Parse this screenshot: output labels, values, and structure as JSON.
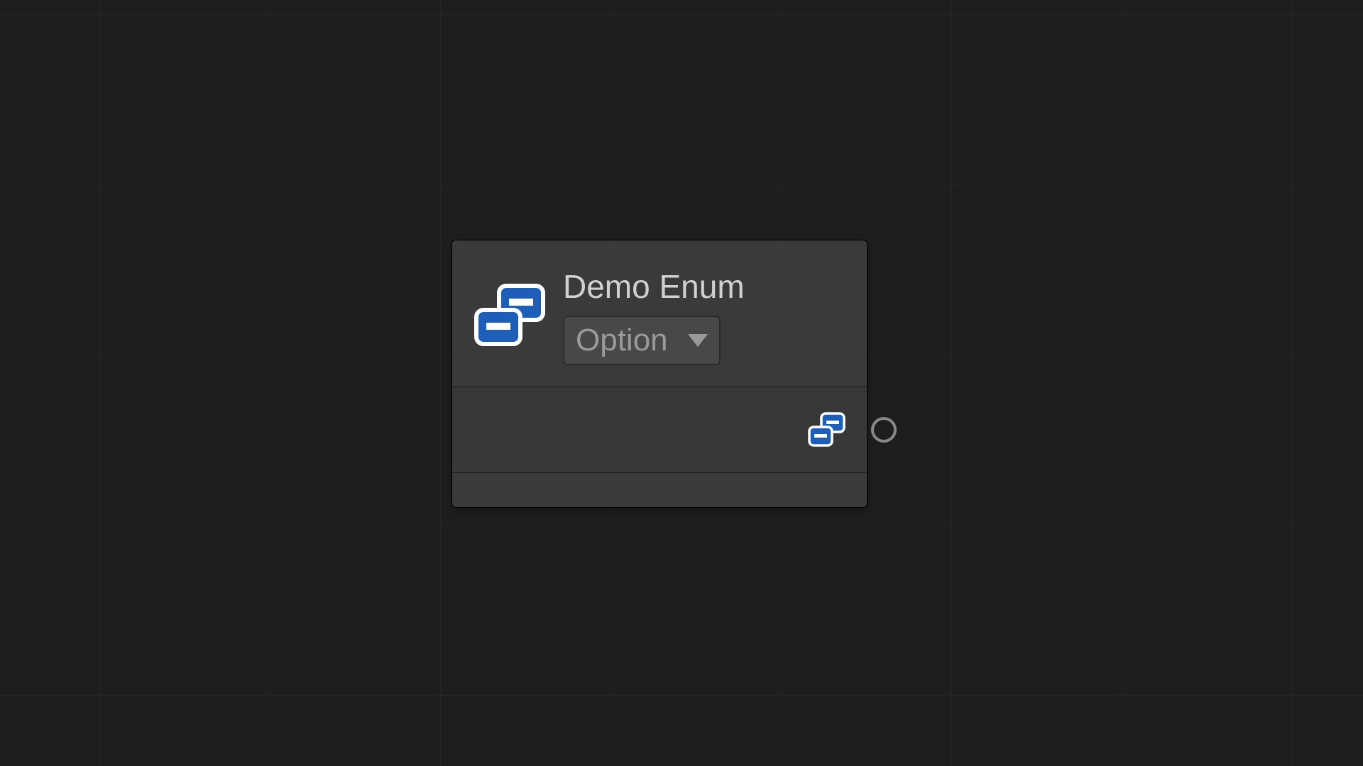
{
  "node": {
    "title": "Demo Enum",
    "dropdown": {
      "selected": "Option"
    },
    "icon": "enum-icon"
  }
}
